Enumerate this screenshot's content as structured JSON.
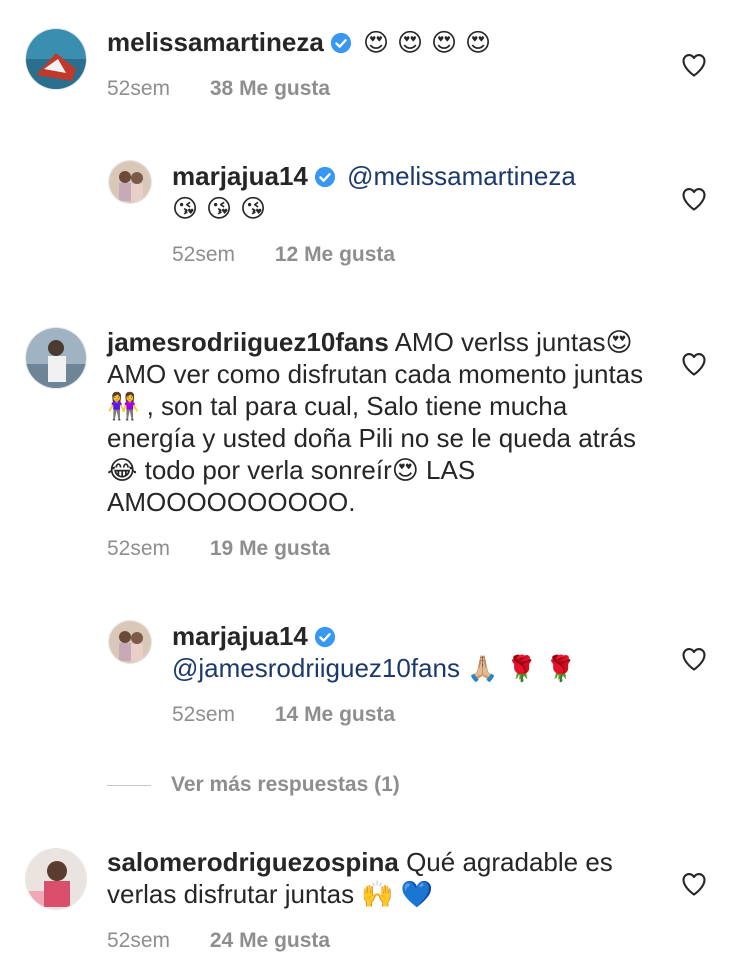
{
  "colors": {
    "text": "#262626",
    "meta": "#8e8e8e",
    "mention": "#1b3a6b",
    "verified": "#3897f0"
  },
  "comments": [
    {
      "username": "melissamartineza",
      "verified": true,
      "text": "😍 😍 😍 😍",
      "time": "52sem",
      "likes": "38 Me gusta"
    },
    {
      "username": "marjajua14",
      "verified": true,
      "mention": "@melissamartineza",
      "text": "😘 😘 😘",
      "time": "52sem",
      "likes": "12 Me gusta",
      "reply": true
    },
    {
      "username": "jamesrodriiguez10fans",
      "verified": false,
      "text": "AMO verlss juntas😍  AMO ver como disfrutan cada momento juntas👭 , son tal para cual, Salo tiene mucha energía y usted doña Pili no se le queda atrás😂  todo por verla sonreír😍  LAS AMOOOOOOOOOO.",
      "time": "52sem",
      "likes": "19 Me gusta"
    },
    {
      "username": "marjajua14",
      "verified": true,
      "mention": "@jamesrodriiguez10fans",
      "text": " 🙏🏼 🌹 🌹",
      "time": "52sem",
      "likes": "14 Me gusta",
      "reply": true
    },
    {
      "username": "salomerodriguezospina",
      "verified": false,
      "text": "Qué agradable es verlas disfrutar juntas 🙌 💙",
      "time": "52sem",
      "likes": "24 Me gusta"
    }
  ],
  "view_more_replies": "Ver más respuestas (1)",
  "icons": {
    "like": "heart-outline-icon",
    "verified": "verified-badge-icon"
  }
}
